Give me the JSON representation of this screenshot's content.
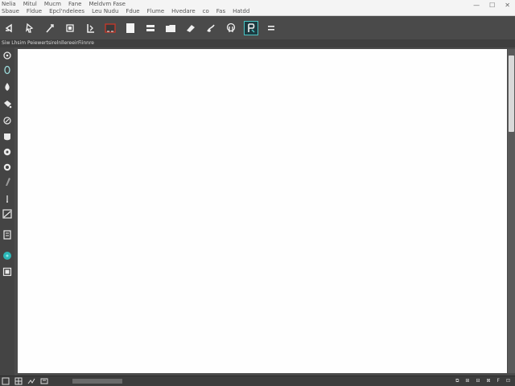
{
  "menu": {
    "row1": [
      "Nelia",
      "Mitul",
      "Mucm",
      "Fane",
      "Meldvm Fase"
    ],
    "row2": [
      "Sbaue",
      "Fldue",
      "Epcl'ndelees",
      "Leu Nudu",
      "Fdue",
      "Flume",
      "Hvedare",
      "co",
      "Fas",
      "Hatdd"
    ]
  },
  "window": {
    "minimize": "—",
    "maximize": "☐",
    "close": "✕"
  },
  "subbar": {
    "text": "Siw Lhsim PeiewertsirelnllereeirFiinnre"
  },
  "colors": {
    "toolbar_bg": "#4a4a4a",
    "canvas_bg": "#fefefe",
    "accent_teal": "#4ac4c4",
    "accent_red": "#c0392b"
  },
  "status": {
    "right_items": [
      "⧉",
      "⊞",
      "⊟",
      "⊠",
      "F",
      "⊡"
    ]
  }
}
